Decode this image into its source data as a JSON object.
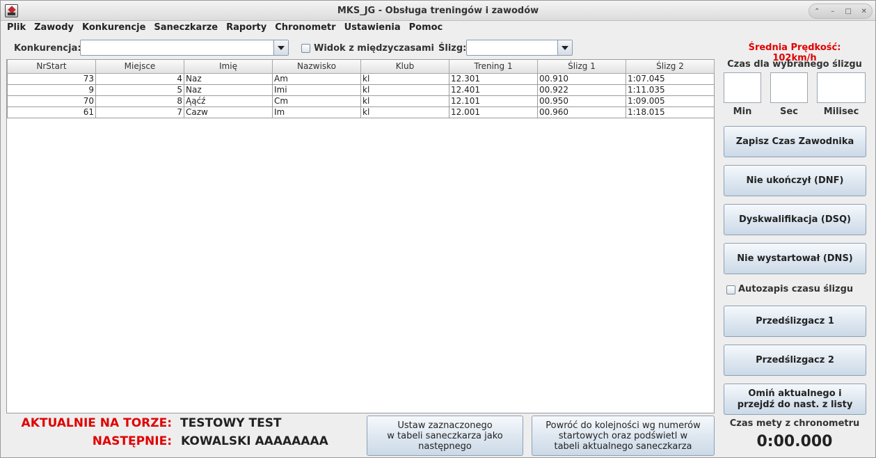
{
  "window": {
    "title": "MKS_JG - Obsługa treningów i zawodów"
  },
  "menu": [
    "Plik",
    "Zawody",
    "Konkurencje",
    "Saneczkarze",
    "Raporty",
    "Chronometr",
    "Ustawienia",
    "Pomoc"
  ],
  "toolbar": {
    "competition_label": "Konkurencja:",
    "competition_value": "",
    "split_view_label": "Widok z międzyczasami",
    "split_view_checked": false,
    "run_label": "Ślizg:",
    "run_value": ""
  },
  "avg_speed": "Średnia Prędkość: 102km/h",
  "table": {
    "columns": [
      "NrStart",
      "Miejsce",
      "Imię",
      "Nazwisko",
      "Klub",
      "Trening 1",
      "Ślizg 1",
      "Ślizg 2"
    ],
    "rows": [
      [
        "73",
        "4",
        "Naz",
        "Am",
        "kl",
        "12.301",
        "00.910",
        "1:07.045"
      ],
      [
        "9",
        "5",
        "Naz",
        "Imi",
        "kl",
        "12.401",
        "00.922",
        "1:11.035"
      ],
      [
        "70",
        "8",
        "Ąąćź",
        "Cm",
        "kl",
        "12.101",
        "00.950",
        "1:09.005"
      ],
      [
        "61",
        "7",
        "Cazw",
        "Im",
        "kl",
        "12.001",
        "00.960",
        "1:18.015"
      ]
    ]
  },
  "time_panel": {
    "title": "Czas dla wybranego ślizgu",
    "min_label": "Min",
    "sec_label": "Sec",
    "ms_label": "Milisec",
    "min_value": "",
    "sec_value": "",
    "ms_value": ""
  },
  "buttons": {
    "save_time": "Zapisz Czas Zawodnika",
    "dnf": "Nie ukończył (DNF)",
    "dsq": "Dyskwalifikacja (DSQ)",
    "dns": "Nie wystartował (DNS)",
    "forerunner1": "Przedślizgacz 1",
    "forerunner2": "Przedślizgacz 2",
    "skip_line1": "Omiń aktualnego i",
    "skip_line2": "przejdź do nast. z listy",
    "set_next_line1": "Ustaw zaznaczonego",
    "set_next_line2": "w tabeli saneczkarza jako",
    "set_next_line3": "następnego",
    "restore_line1": "Powróć do kolejności wg numerów",
    "restore_line2": "startowych oraz podświetl w",
    "restore_line3": "tabeli aktualnego saneczkarza"
  },
  "autosave": {
    "label": "Autozapis czasu ślizgu",
    "checked": false
  },
  "status": {
    "on_track_label": "AKTUALNIE NA TORZE:",
    "on_track_value": "TESTOWY TEST",
    "next_label": "NASTĘPNIE:",
    "next_value": "KOWALSKI AAAAAAAA"
  },
  "chrono": {
    "label": "Czas mety z chronometru",
    "value": "0:00.000"
  },
  "colors": {
    "accent_red": "#e10000",
    "button_blue": "#cbd9e7"
  }
}
